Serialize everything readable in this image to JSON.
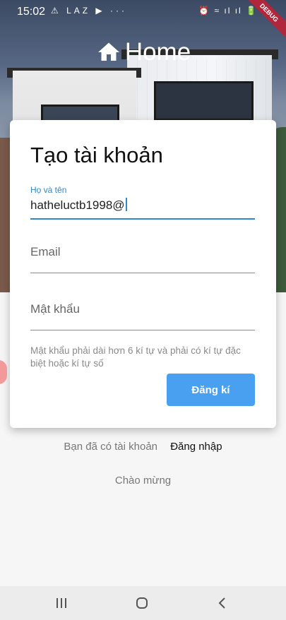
{
  "status_bar": {
    "time": "15:02",
    "left_icons": "⚠ LAZ ▶ ···",
    "right_icons": "⏰ ≈ ıl ıl 🔋",
    "debug_label": "DEBUG"
  },
  "header": {
    "title": "Home",
    "icon": "home-icon"
  },
  "form": {
    "title": "Tạo tài khoản",
    "name_label": "Họ và tên",
    "name_value": "hatheluctb1998@",
    "email_placeholder": "Email",
    "password_placeholder": "Mật khẩu",
    "hint": "Mật khẩu phải dài hơn 6 kí tự và phải có kí tự đặc biệt hoặc kí tự số",
    "submit_label": "Đăng kí"
  },
  "login": {
    "question": "Bạn đã có tài khoản",
    "link": "Đăng nhập"
  },
  "welcome": "Chào mừng",
  "colors": {
    "accent": "#2f86c8",
    "button": "#4aa0f0",
    "ribbon": "#b0263a"
  },
  "nav": {
    "recents_icon": "recents-icon",
    "home_icon": "home-circle-icon",
    "back_icon": "back-icon"
  }
}
